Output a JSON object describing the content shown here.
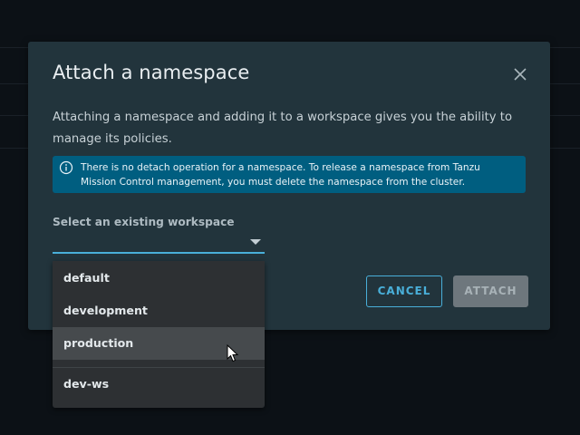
{
  "modal": {
    "title": "Attach a namespace",
    "description": "Attaching a namespace and adding it to a workspace gives you the ability to manage its policies.",
    "alert_text": "There is no detach operation for a namespace. To release a namespace from Tanzu Mission Control management, you must delete the namespace from the cluster.",
    "alert_icon": "info-circle-icon",
    "close_icon": "close-icon",
    "workspace_label": "Select an existing workspace",
    "workspace_value": "",
    "cancel_label": "CANCEL",
    "attach_label": "ATTACH"
  },
  "dropdown": {
    "options": [
      "default",
      "development",
      "production",
      "dev-ws"
    ],
    "hovered": "production"
  },
  "colors": {
    "modal_bg": "#22343c",
    "alert_bg": "#005e80",
    "accent": "#49afd9",
    "dropdown_bg": "#2d3033",
    "hover_bg": "#464a4d",
    "disabled_button": "#6e777d"
  }
}
